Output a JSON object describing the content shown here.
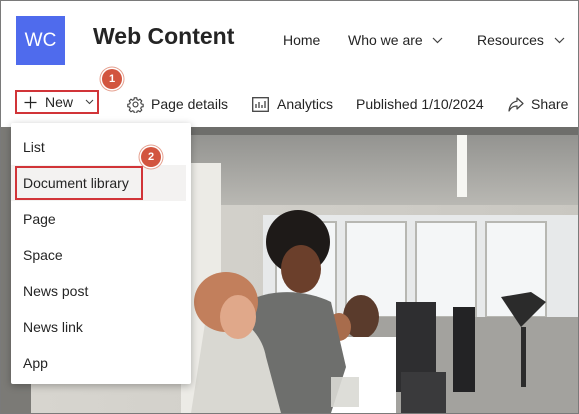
{
  "site": {
    "logo_initials": "WC",
    "title": "Web Content"
  },
  "nav": [
    {
      "label": "Home",
      "has_dropdown": false
    },
    {
      "label": "Who we are",
      "has_dropdown": true
    },
    {
      "label": "Resources",
      "has_dropdown": true
    }
  ],
  "command_bar": {
    "new_label": "New",
    "page_details_label": "Page details",
    "analytics_label": "Analytics",
    "published_label": "Published 1/10/2024",
    "share_label": "Share"
  },
  "callouts": {
    "step1": "1",
    "step2": "2"
  },
  "new_menu": {
    "items": [
      {
        "label": "List"
      },
      {
        "label": "Document library",
        "highlighted": true
      },
      {
        "label": "Page"
      },
      {
        "label": "Space"
      },
      {
        "label": "News post"
      },
      {
        "label": "News link"
      },
      {
        "label": "App"
      }
    ]
  },
  "colors": {
    "logo_bg": "#4f6bed",
    "callout_border": "#d13438",
    "badge_bg": "#d2553f"
  },
  "icons": [
    "plus-icon",
    "chevron-down-icon",
    "gear-icon",
    "analytics-icon",
    "share-icon"
  ]
}
